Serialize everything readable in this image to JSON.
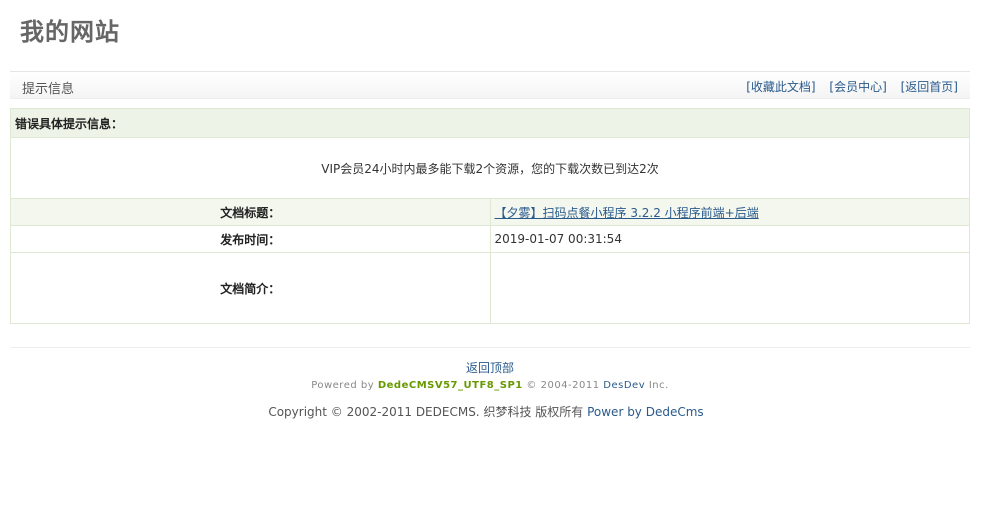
{
  "site": {
    "title": "我的网站"
  },
  "position_bar": {
    "title": "提示信息",
    "links": [
      "[收藏此文档]",
      "[会员中心]",
      "[返回首页]"
    ]
  },
  "error": {
    "header": "错误具体提示信息：",
    "message": "VIP会员24小时内最多能下载2个资源，您的下载次数已到达2次"
  },
  "document": {
    "title_label": "文档标题：",
    "title_value": "【夕雾】扫码点餐小程序 3.2.2 小程序前端+后端",
    "date_label": "发布时间：",
    "date_value": "2019-01-07 00:31:54",
    "desc_label": "文档简介：",
    "desc_value": ""
  },
  "footer": {
    "back_top": "返回顶部",
    "powered_prefix": "Powered by",
    "powered_product": "DedeCMSV57_UTF8_SP1",
    "powered_years": "© 2004-2011",
    "powered_dev": "DesDev",
    "powered_suffix": "Inc.",
    "copyright": "Copyright © 2002-2011 DEDECMS. 织梦科技 版权所有",
    "copyright_link": "Power by DedeCms"
  },
  "colors": {
    "link": "#2a5a8c",
    "table_border": "#dfe8d3",
    "table_header_bg": "#edf3e6",
    "product_green": "#669900"
  }
}
